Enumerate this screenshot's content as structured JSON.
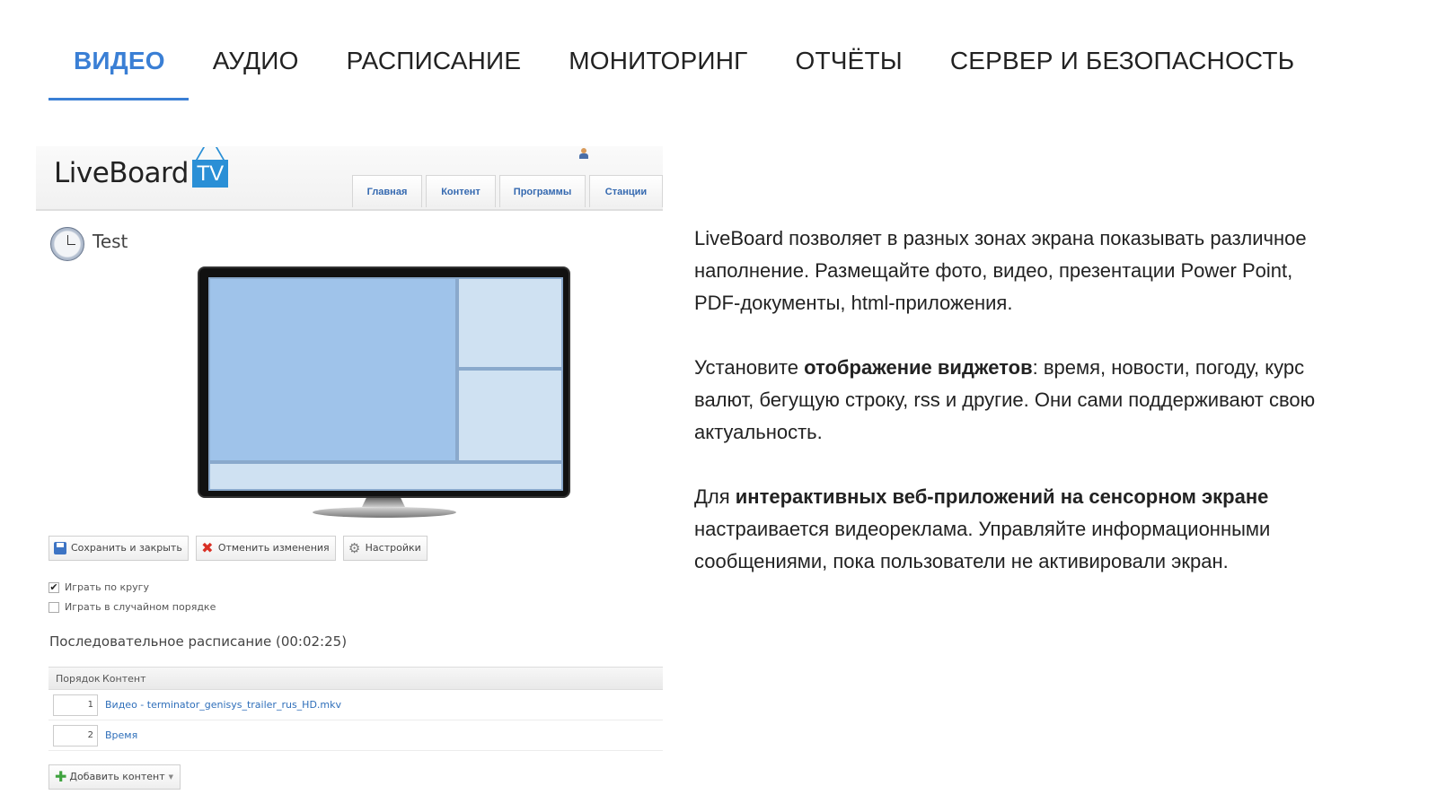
{
  "tabs": [
    "ВИДЕО",
    "АУДИО",
    "РАСПИСАНИЕ",
    "МОНИТОРИНГ",
    "ОТЧЁТЫ",
    "СЕРВЕР И БЕЗОПАСНОСТЬ"
  ],
  "active_tab": "ВИДЕО",
  "colors": {
    "accent": "#3a7fd5",
    "link": "#2f6fba",
    "zone_main": "#9fc3ea",
    "zone_secondary": "#cfe1f2"
  },
  "app": {
    "logo_text": "LiveBoard",
    "logo_badge": "TV",
    "nav": [
      "Главная",
      "Контент",
      "Программы",
      "Станции"
    ],
    "title": "Test",
    "toolbar": {
      "save": "Сохранить и закрыть",
      "cancel": "Отменить изменения",
      "settings": "Настройки"
    },
    "options": [
      {
        "label": "Играть по кругу",
        "checked": true
      },
      {
        "label": "Играть в случайном порядке",
        "checked": false
      }
    ],
    "schedule_title": "Последовательное расписание (00:02:25)",
    "table": {
      "headers": [
        "Порядок",
        "Контент"
      ],
      "rows": [
        {
          "order": "1",
          "content": "Видео - terminator_genisys_trailer_rus_HD.mkv"
        },
        {
          "order": "2",
          "content": "Время"
        }
      ]
    },
    "add_button": "Добавить контент"
  },
  "description": {
    "p1": "LiveBoard позволяет в разных зонах экрана показывать различное наполнение. Размещайте фото, видео, презентации Power Point, PDF-документы, html-приложения.",
    "p2_before": "Установите ",
    "p2_bold": "отображение виджетов",
    "p2_after": ": время, новости, погоду, курс валют, бегущую строку, rss и другие. Они сами поддерживают свою актуальность.",
    "p3_before": "Для ",
    "p3_bold": "интерактивных веб-приложений на сенсорном экране",
    "p3_after": " настраивается видеореклама. Управляйте информационными сообщениями, пока пользователи не активировали экран."
  }
}
